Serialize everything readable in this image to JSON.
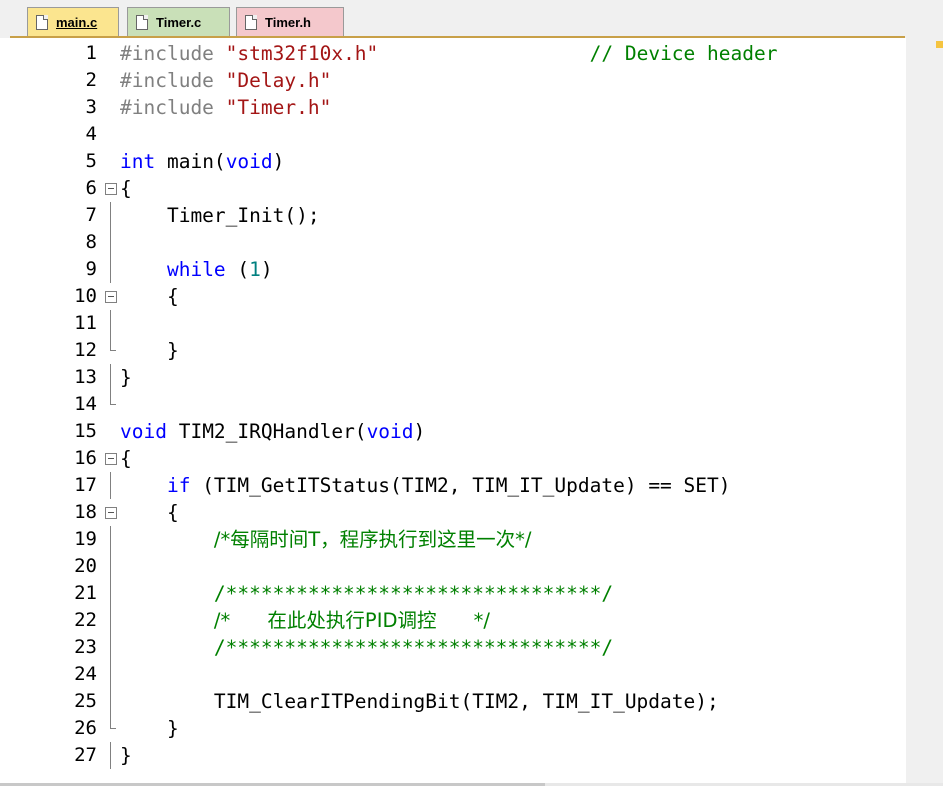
{
  "tabs": [
    {
      "label": "main.c",
      "icon": "file-c-icon",
      "active": true
    },
    {
      "label": "Timer.c",
      "icon": "file-c-icon",
      "active": false
    },
    {
      "label": "Timer.h",
      "icon": "file-h-icon",
      "active": false
    }
  ],
  "lines": [
    {
      "n": "1",
      "parts": [
        {
          "t": "#include ",
          "c": "pp"
        },
        {
          "t": "\"stm32f10x.h\"",
          "c": "str"
        },
        {
          "t": "                  ",
          "c": ""
        },
        {
          "t": "// Device header",
          "c": "cm"
        }
      ]
    },
    {
      "n": "2",
      "parts": [
        {
          "t": "#include ",
          "c": "pp"
        },
        {
          "t": "\"Delay.h\"",
          "c": "str"
        }
      ]
    },
    {
      "n": "3",
      "parts": [
        {
          "t": "#include ",
          "c": "pp"
        },
        {
          "t": "\"Timer.h\"",
          "c": "str"
        }
      ]
    },
    {
      "n": "4",
      "parts": []
    },
    {
      "n": "5",
      "parts": [
        {
          "t": "int",
          "c": "kw"
        },
        {
          "t": " main(",
          "c": ""
        },
        {
          "t": "void",
          "c": "kw"
        },
        {
          "t": ")",
          "c": ""
        }
      ]
    },
    {
      "n": "6",
      "parts": [
        {
          "t": "{",
          "c": ""
        }
      ]
    },
    {
      "n": "7",
      "parts": [
        {
          "t": "    Timer_Init();",
          "c": ""
        }
      ]
    },
    {
      "n": "8",
      "parts": []
    },
    {
      "n": "9",
      "parts": [
        {
          "t": "    ",
          "c": ""
        },
        {
          "t": "while",
          "c": "kw"
        },
        {
          "t": " (",
          "c": ""
        },
        {
          "t": "1",
          "c": "num"
        },
        {
          "t": ")",
          "c": ""
        }
      ]
    },
    {
      "n": "10",
      "parts": [
        {
          "t": "    {",
          "c": ""
        }
      ]
    },
    {
      "n": "11",
      "parts": []
    },
    {
      "n": "12",
      "parts": [
        {
          "t": "    }",
          "c": ""
        }
      ]
    },
    {
      "n": "13",
      "parts": [
        {
          "t": "}",
          "c": ""
        }
      ]
    },
    {
      "n": "14",
      "parts": []
    },
    {
      "n": "15",
      "parts": [
        {
          "t": "void",
          "c": "kw"
        },
        {
          "t": " TIM2_IRQHandler(",
          "c": ""
        },
        {
          "t": "void",
          "c": "kw"
        },
        {
          "t": ")",
          "c": ""
        }
      ]
    },
    {
      "n": "16",
      "parts": [
        {
          "t": "{",
          "c": ""
        }
      ]
    },
    {
      "n": "17",
      "parts": [
        {
          "t": "    ",
          "c": ""
        },
        {
          "t": "if",
          "c": "kw"
        },
        {
          "t": " (TIM_GetITStatus(TIM2, TIM_IT_Update) == SET)",
          "c": ""
        }
      ]
    },
    {
      "n": "18",
      "parts": [
        {
          "t": "    {",
          "c": ""
        }
      ]
    },
    {
      "n": "19",
      "parts": [
        {
          "t": "        ",
          "c": ""
        },
        {
          "t": "/*每隔时间T，程序执行到这里一次*/",
          "c": "cm"
        }
      ]
    },
    {
      "n": "20",
      "parts": []
    },
    {
      "n": "21",
      "parts": [
        {
          "t": "        ",
          "c": ""
        },
        {
          "t": "/********************************/",
          "c": "cm"
        }
      ]
    },
    {
      "n": "22",
      "parts": [
        {
          "t": "        ",
          "c": ""
        },
        {
          "t": "/*      在此处执行PID调控      */",
          "c": "cm"
        }
      ]
    },
    {
      "n": "23",
      "parts": [
        {
          "t": "        ",
          "c": ""
        },
        {
          "t": "/********************************/",
          "c": "cm"
        }
      ]
    },
    {
      "n": "24",
      "parts": []
    },
    {
      "n": "25",
      "parts": [
        {
          "t": "        TIM_ClearITPendingBit(TIM2, TIM_IT_Update);",
          "c": ""
        }
      ]
    },
    {
      "n": "26",
      "parts": [
        {
          "t": "    }",
          "c": ""
        }
      ]
    },
    {
      "n": "27",
      "parts": [
        {
          "t": "}",
          "c": ""
        }
      ]
    }
  ],
  "folds": {
    "6": "box",
    "7": "bar",
    "8": "bar",
    "9": "bar",
    "10": "box",
    "11": "bar",
    "12": "end",
    "13": "bar",
    "14": "end",
    "16": "box",
    "17": "bar",
    "18": "box",
    "19": "bar",
    "20": "bar",
    "21": "bar",
    "22": "bar",
    "23": "bar",
    "24": "bar",
    "25": "bar",
    "26": "end",
    "27": "bar"
  },
  "colors": {
    "keyword": "#0000ff",
    "preprocessor": "#808080",
    "string": "#a31515",
    "comment": "#008000",
    "number": "#008080",
    "tab_main": "#fbe58f",
    "tab_timer_c": "#c9e0b8",
    "tab_timer_h": "#f4c8cc"
  }
}
